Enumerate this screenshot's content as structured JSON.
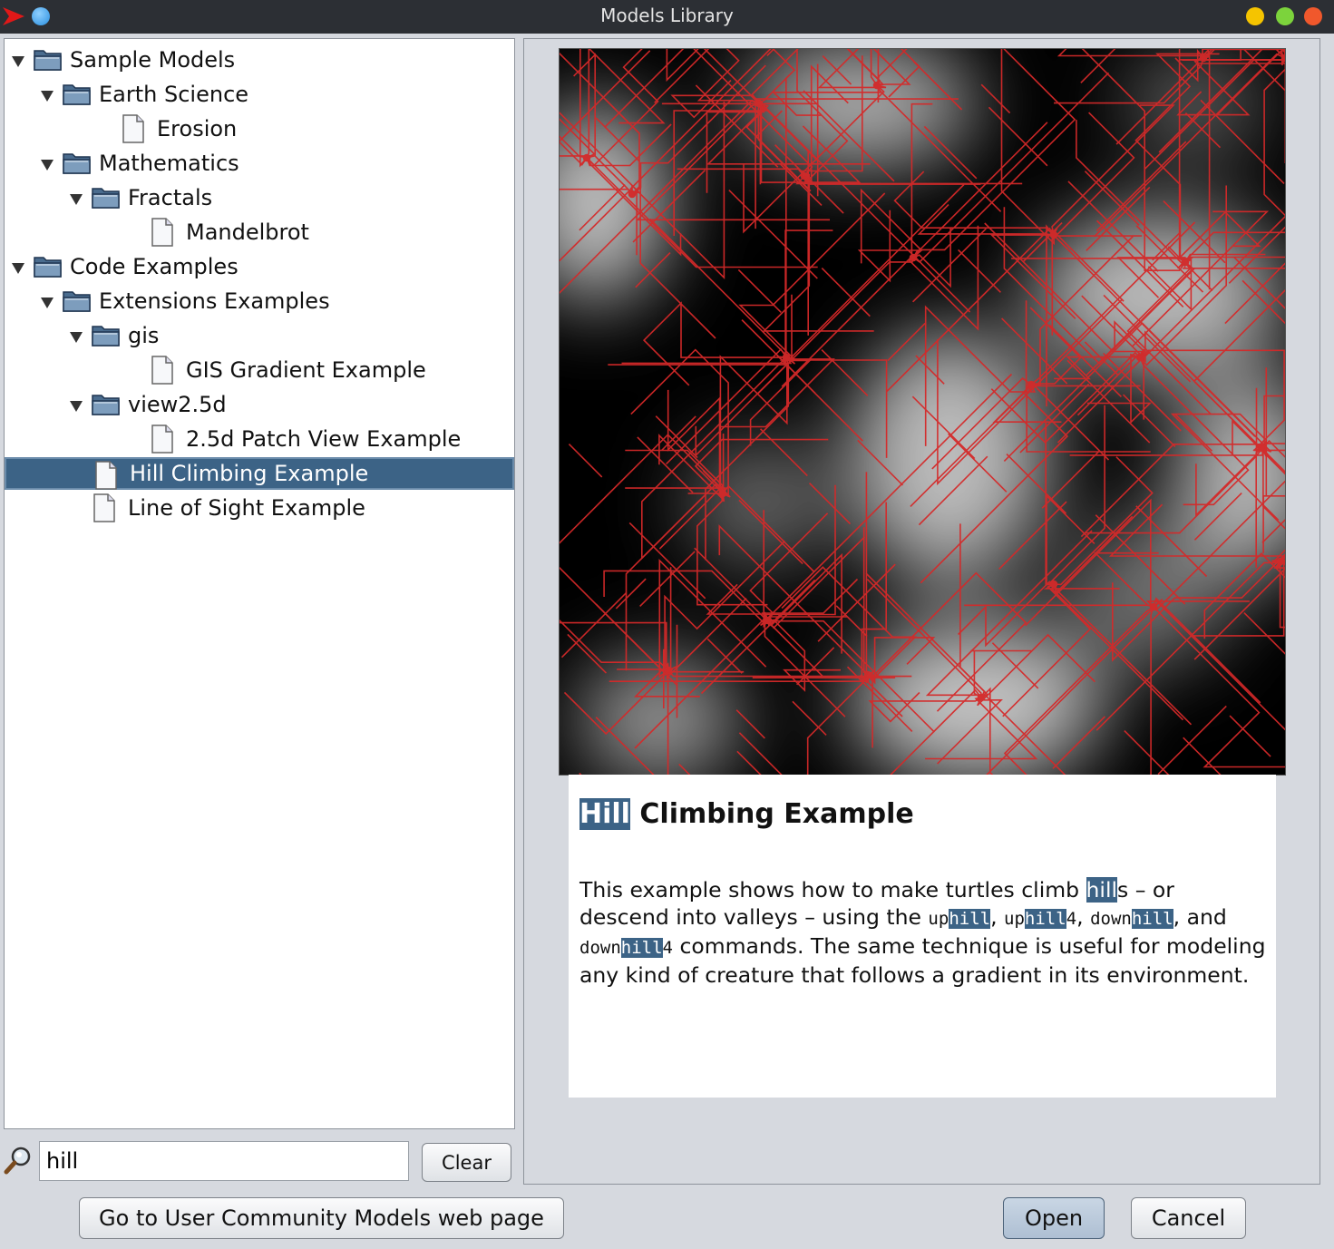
{
  "window": {
    "title": "Models Library"
  },
  "tree": {
    "items": [
      {
        "label": "Sample Models",
        "type": "folder",
        "depth": 0,
        "expanded": true
      },
      {
        "label": "Earth Science",
        "type": "folder",
        "depth": 1,
        "expanded": true
      },
      {
        "label": "Erosion",
        "type": "file",
        "depth": 2
      },
      {
        "label": "Mathematics",
        "type": "folder",
        "depth": 1,
        "expanded": true
      },
      {
        "label": "Fractals",
        "type": "folder",
        "depth": 2,
        "expanded": true
      },
      {
        "label": "Mandelbrot",
        "type": "file",
        "depth": 3
      },
      {
        "label": "Code Examples",
        "type": "folder",
        "depth": 0,
        "expanded": true
      },
      {
        "label": "Extensions Examples",
        "type": "folder",
        "depth": 1,
        "expanded": true
      },
      {
        "label": "gis",
        "type": "folder",
        "depth": 2,
        "expanded": true
      },
      {
        "label": "GIS Gradient Example",
        "type": "file",
        "depth": 3
      },
      {
        "label": "view2.5d",
        "type": "folder",
        "depth": 2,
        "expanded": true
      },
      {
        "label": "2.5d Patch View Example",
        "type": "file",
        "depth": 3
      },
      {
        "label": "Hill Climbing Example",
        "type": "file",
        "depth": 1,
        "selected": true
      },
      {
        "label": "Line of Sight Example",
        "type": "file",
        "depth": 1
      }
    ]
  },
  "search": {
    "value": "hill",
    "clear_label": "Clear",
    "icon": "magnifier-icon"
  },
  "buttons": {
    "community": "Go to User Community Models web page",
    "open": "Open",
    "cancel": "Cancel"
  },
  "description": {
    "title_highlight": "Hill",
    "title_rest": " Climbing Example",
    "body": [
      {
        "t": "This example shows how to make turtles climb "
      },
      {
        "t": "hill",
        "hl": true
      },
      {
        "t": "s – or descend into valleys – using the "
      },
      {
        "t": "up",
        "code": true
      },
      {
        "t": "hill",
        "code": true,
        "hl": true
      },
      {
        "t": ", "
      },
      {
        "t": "up",
        "code": true
      },
      {
        "t": "hill",
        "code": true,
        "hl": true
      },
      {
        "t": "4",
        "code": true
      },
      {
        "t": ", "
      },
      {
        "t": "down",
        "code": true
      },
      {
        "t": "hill",
        "code": true,
        "hl": true
      },
      {
        "t": ", and "
      },
      {
        "t": "down",
        "code": true
      },
      {
        "t": "hill",
        "code": true,
        "hl": true
      },
      {
        "t": "4",
        "code": true
      },
      {
        "t": " commands. The same technique is useful for modeling any kind of creature that follows a gradient in its environment."
      }
    ]
  },
  "colors": {
    "selection": "#3c6386",
    "titlebar": "#2c2f34",
    "trail": "#d42a2a",
    "window_buttons": [
      "#f5c400",
      "#7cd33c",
      "#f0582c"
    ]
  }
}
